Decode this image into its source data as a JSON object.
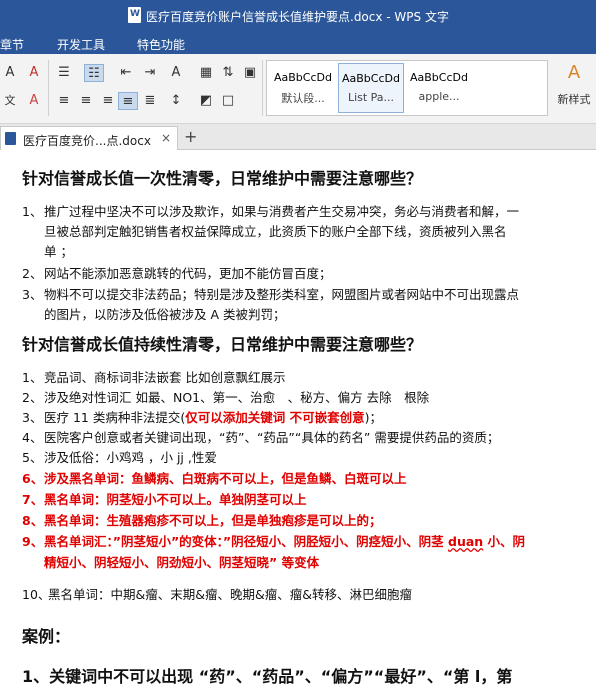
{
  "window": {
    "title": "医疗百度竞价账户信誉成长值维护要点.docx - WPS 文字"
  },
  "menu": {
    "items": [
      "章节",
      "开发工具",
      "特色功能"
    ]
  },
  "ribbon": {
    "styles": [
      {
        "sample": "AaBbCcDd",
        "name": "默认段..."
      },
      {
        "sample": "AaBbCcDd",
        "name": "List Pa..."
      },
      {
        "sample": "AaBbCcDd",
        "name": "apple..."
      }
    ],
    "new_style_label": "新样式"
  },
  "tab": {
    "label": "医疗百度竞价...点.docx",
    "close": "×",
    "new": "+"
  },
  "doc": {
    "h1": "针对信誉成长值一次性清零，日常维护中需要注意哪些？",
    "s1": [
      {
        "n": "1、",
        "l1": "推广过程中坚决不可以涉及欺诈，如果与消费者产生交易冲突，务必与消费者和解，一",
        "l2": "旦被总部判定触犯销售者权益保障成立，此资质下的账户全部下线，资质被列入黑名",
        "l3": "单 ；"
      },
      {
        "n": "2、",
        "l1": "网站不能添加恶意跳转的代码，更加不能仿冒百度；"
      },
      {
        "n": "3、",
        "l1": "物料不可以提交非法药品；特别是涉及整形类科室，网盟图片或者网站中不可出现露点",
        "l2": "的图片，以防涉及低俗被涉及 A 类被判罚；"
      }
    ],
    "h2": "针对信誉成长值持续性清零，日常维护中需要注意哪些？",
    "s2": [
      {
        "n": "1、",
        "t": "竞品词、商标词非法嵌套 比如创意飘红展示"
      },
      {
        "n": "2、",
        "t": "涉及绝对性词汇 如最、NO1、第一、治愈　、秘方、偏方 去除　根除"
      },
      {
        "n": "3、",
        "t": "医疗 11 类病种非法提交(",
        "red": "仅可以添加关键词 不可嵌套创意",
        "end": ")；"
      },
      {
        "n": "4、",
        "t": "医院客户创意或者关键词出现，“药”、“药品”“具体的药名” 需要提供药品的资质；"
      },
      {
        "n": "5、",
        "t": "涉及低俗：小鸡鸡 ，小 jj ,性爱"
      },
      {
        "n": "6、",
        "t": "涉及黑名单词：鱼鳞病、白斑病不可以上，但是鱼鳞、白斑可以上"
      },
      {
        "n": "7、",
        "t": "黑名单词：阴茎短小不可以上。单独阴茎可以上"
      },
      {
        "n": "8、",
        "t": "黑名单词：生殖器疱疹不可以上，但是单独疱疹是可以上的；"
      },
      {
        "n": "9、",
        "t": "黑名单词汇：”阴茎短小”的变体：”阴径短小、阴胫短小、阴痉短小、阴茎 ",
        "wavy": "duan",
        "t2": " 小、阴",
        "l2": "精短小、阴轻短小、阴劲短小、阴茎短晓” 等变体"
      },
      {
        "n": "10、",
        "t": "黑名单词：中期&瘤、末期&瘤、晚期&瘤、瘤&转移、淋巴细胞瘤"
      }
    ],
    "h3": "案例：",
    "h4": "1、关键词中不可以出现 “药”、“药品”、“偏方”“最好”、“第 l，第"
  }
}
